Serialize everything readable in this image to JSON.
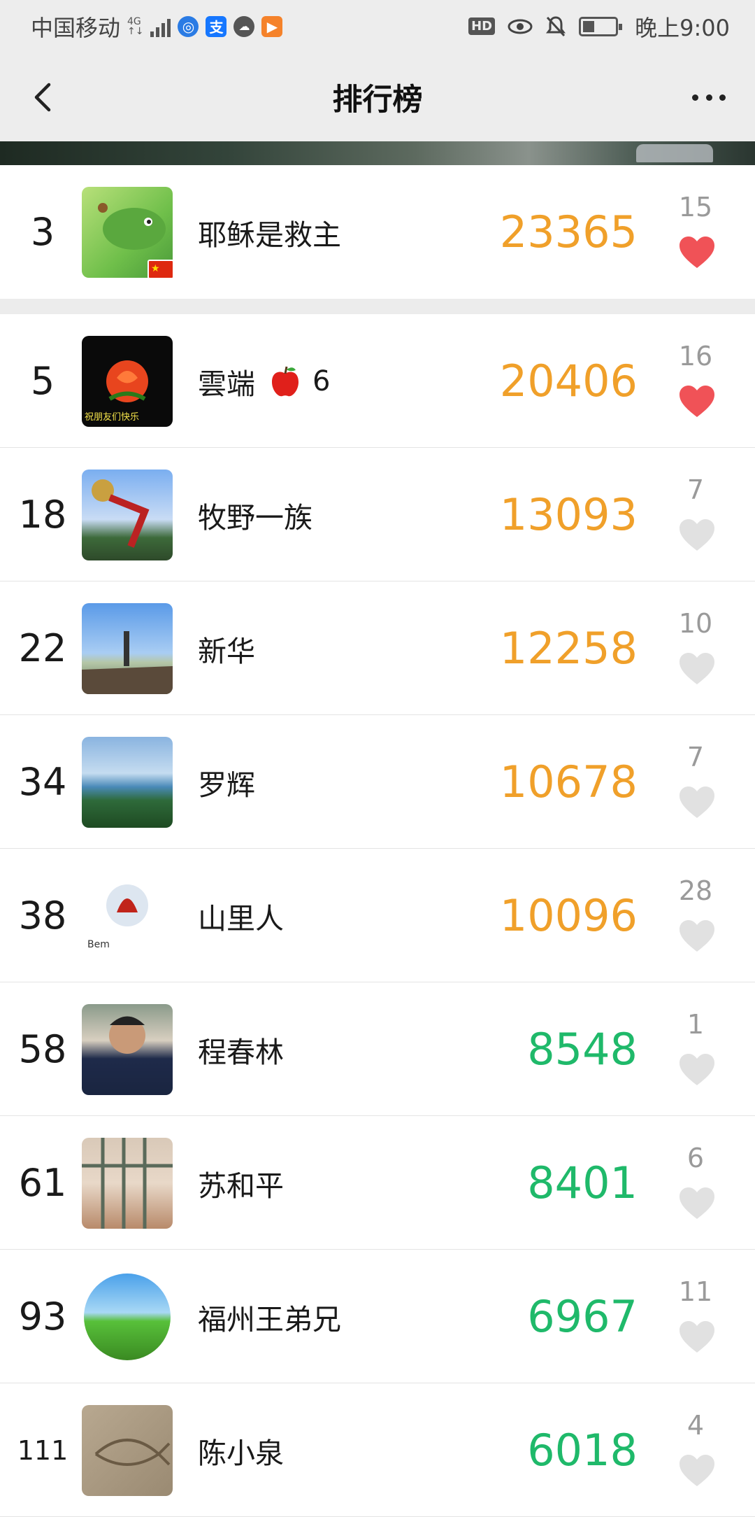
{
  "status_bar": {
    "carrier": "中国移动",
    "network": "4G",
    "hd": "HD",
    "time": "晚上9:00",
    "battery_level": 0.35
  },
  "nav": {
    "title": "排行榜",
    "back_icon": "chevron-left-icon",
    "more_icon": "more-dots-icon"
  },
  "self_entry": {
    "rank": "3",
    "name": "耶稣是救主",
    "steps": "23365",
    "likes": "15",
    "liked": true
  },
  "entries": [
    {
      "rank": "5",
      "name": "雲端",
      "name_suffix": "6",
      "name_emoji": "apple",
      "steps": "20406",
      "likes": "16",
      "liked": true,
      "steps_color": "orange"
    },
    {
      "rank": "18",
      "name": "牧野一族",
      "steps": "13093",
      "likes": "7",
      "liked": false,
      "steps_color": "orange"
    },
    {
      "rank": "22",
      "name": "新华",
      "steps": "12258",
      "likes": "10",
      "liked": false,
      "steps_color": "orange"
    },
    {
      "rank": "34",
      "name": " 罗辉",
      "steps": "10678",
      "likes": "7",
      "liked": false,
      "steps_color": "orange"
    },
    {
      "rank": "38",
      "name": "山里人",
      "steps": "10096",
      "likes": "28",
      "liked": false,
      "steps_color": "orange"
    },
    {
      "rank": "58",
      "name": "程春林",
      "steps": "8548",
      "likes": "1",
      "liked": false,
      "steps_color": "green"
    },
    {
      "rank": "61",
      "name": "苏和平",
      "steps": "8401",
      "likes": "6",
      "liked": false,
      "steps_color": "green"
    },
    {
      "rank": "93",
      "name": "福州王弟兄",
      "steps": "6967",
      "likes": "11",
      "liked": false,
      "steps_color": "green"
    },
    {
      "rank": "111",
      "name": "陈小泉",
      "steps": "6018",
      "likes": "4",
      "liked": false,
      "steps_color": "green"
    }
  ],
  "colors": {
    "orange": "#f0a02a",
    "green": "#1fb96a",
    "heart_active": "#f05257",
    "heart_inactive": "#e1e1e1"
  }
}
